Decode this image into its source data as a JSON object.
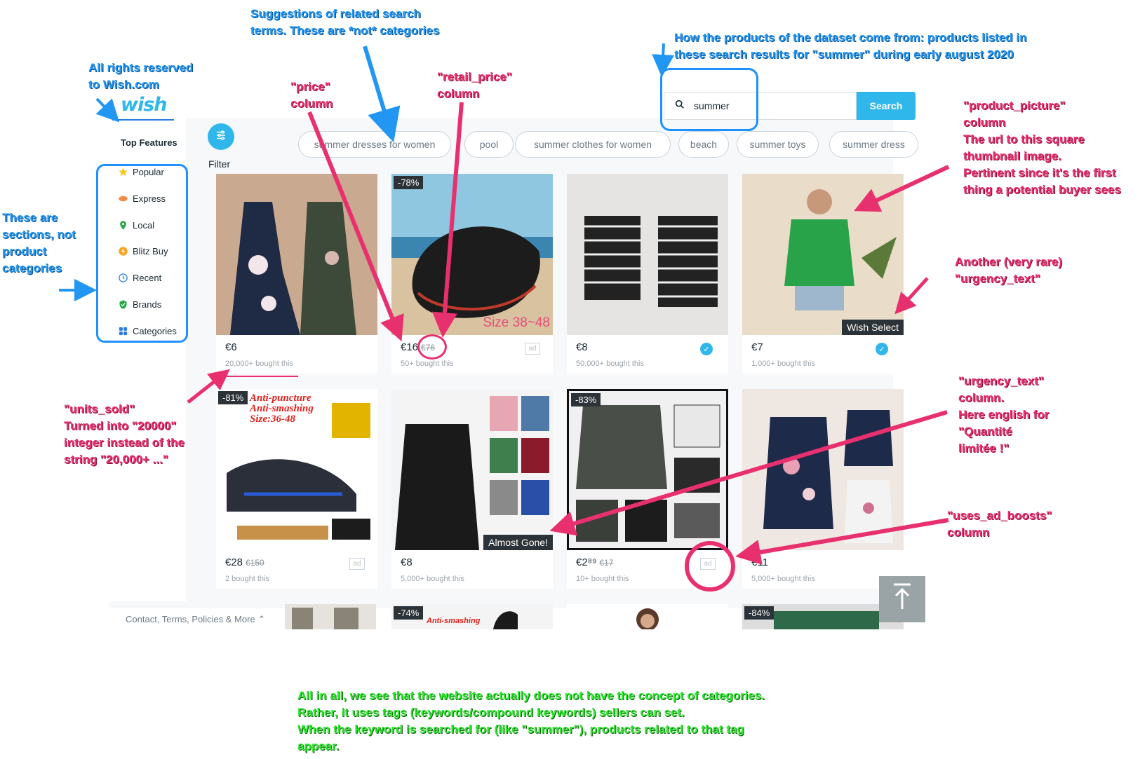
{
  "brand": {
    "logo_text": "wish",
    "colors": {
      "accent": "#2fb7ec",
      "annotation_blue": "#2196f3",
      "annotation_pink": "#e8306f",
      "annotation_green": "#2ee82e"
    }
  },
  "sidebar": {
    "title": "Top Features",
    "items": [
      {
        "label": "Popular",
        "icon": "star-icon"
      },
      {
        "label": "Express",
        "icon": "truck-icon"
      },
      {
        "label": "Local",
        "icon": "pin-icon"
      },
      {
        "label": "Blitz Buy",
        "icon": "blitz-icon"
      },
      {
        "label": "Recent",
        "icon": "clock-icon"
      },
      {
        "label": "Brands",
        "icon": "shield-check-icon"
      },
      {
        "label": "Categories",
        "icon": "grid-icon"
      }
    ]
  },
  "filter": {
    "label": "Filter"
  },
  "search": {
    "value": "summer",
    "button_label": "Search"
  },
  "suggestions": [
    "summer dresses for women",
    "pool",
    "summer clothes for women",
    "beach",
    "summer toys",
    "summer dress"
  ],
  "products": [
    {
      "price": "€6",
      "retail": "",
      "sold": "20,000+ bought this",
      "badge": "",
      "urgency": "",
      "ad": false,
      "verified": false
    },
    {
      "price": "€16",
      "retail": "€76",
      "sold": "50+ bought this",
      "badge": "-78%",
      "urgency": "",
      "ad": true,
      "verified": false,
      "overlay": "Size 38~48"
    },
    {
      "price": "€8",
      "retail": "",
      "sold": "50,000+ bought this",
      "badge": "",
      "urgency": "",
      "ad": false,
      "verified": true
    },
    {
      "price": "€7",
      "retail": "",
      "sold": "1,000+ bought this",
      "badge": "",
      "urgency": "Wish Select",
      "ad": false,
      "verified": true
    },
    {
      "price": "€28",
      "retail": "€150",
      "sold": "2 bought this",
      "badge": "-81%",
      "urgency": "",
      "ad": true,
      "verified": false,
      "overlay": "Anti-puncture\nAnti-smashing\nSize:36-48"
    },
    {
      "price": "€8",
      "retail": "",
      "sold": "5,000+ bought this",
      "badge": "",
      "urgency": "Almost Gone!",
      "ad": false,
      "verified": false
    },
    {
      "price": "€2⁸⁹",
      "retail": "€17",
      "sold": "10+ bought this",
      "badge": "-83%",
      "urgency": "",
      "ad": true,
      "verified": false
    },
    {
      "price": "€11",
      "retail": "",
      "sold": "5,000+ bought this",
      "badge": "",
      "urgency": "",
      "ad": false,
      "verified": false
    }
  ],
  "partial_row": [
    {
      "badge": ""
    },
    {
      "badge": "-74%",
      "overlay": "Anti-smashing"
    },
    {
      "badge": ""
    },
    {
      "badge": "-84%"
    }
  ],
  "footer": {
    "link": "Contact, Terms, Policies & More ⌃"
  },
  "ad_label": "ad",
  "annotations": {
    "rights": "All rights reserved\nto Wish.com",
    "suggestions": "Suggestions of related search\nterms. These are *not* categories",
    "dataset": "How the products of the dataset come from: products listed in\nthese search results for \"summer\" during early august 2020",
    "sections": "These are\nsections, not\nproduct\ncategories",
    "price": "\"price\"\ncolumn",
    "retail_price": "\"retail_price\"\ncolumn",
    "product_picture": "\"product_picture\"\ncolumn\nThe url to this square\nthumbnail image.\nPertinent since it's the first\nthing a potential buyer sees",
    "rare_urgency": "Another (very rare)\n\"urgency_text\"",
    "units_sold": "\"units_sold\"\nTurned into \"20000\"\ninteger instead of the\nstring \"20,000+ ...\"",
    "urgency_text": "\"urgency_text\"\ncolumn.\nHere english for\n\"Quantité\nlimitée !\"",
    "ad_boosts": "\"uses_ad_boosts\"\ncolumn",
    "conclusion": "All in all, we see that the website actually does not have the concept of categories.\nRather, it uses tags (keywords/compound keywords) sellers can set.\nWhen the keyword is searched for (like \"summer\"), products related to that tag\nappear."
  }
}
